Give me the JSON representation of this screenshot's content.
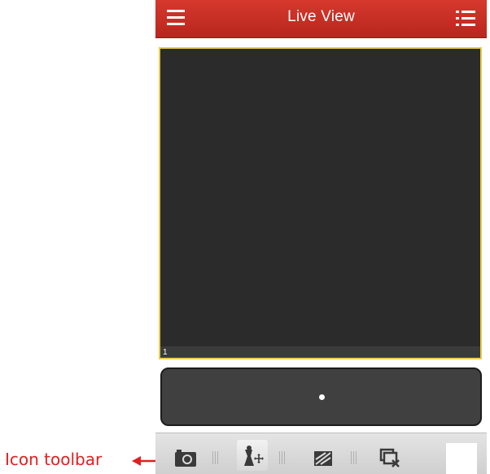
{
  "header": {
    "title": "Live View",
    "left_icon": "hamburger-menu-icon",
    "right_icon": "device-list-icon",
    "background_color": "#c4312a"
  },
  "video": {
    "window_number": "1",
    "selected_border_color": "#e8cc4a",
    "background_color": "#2b2b2b"
  },
  "page_panel": {
    "page_count": 1,
    "current_page": 1
  },
  "toolbar": {
    "items": [
      {
        "name": "capture",
        "icon": "camera-icon"
      },
      {
        "name": "ptz",
        "icon": "ptz-control-icon",
        "active": true
      },
      {
        "name": "image-quality",
        "icon": "image-quality-icon"
      },
      {
        "name": "stop-live-view",
        "icon": "close-window-icon"
      }
    ]
  },
  "annotation": {
    "label": "Icon toolbar",
    "color": "#e02020"
  }
}
